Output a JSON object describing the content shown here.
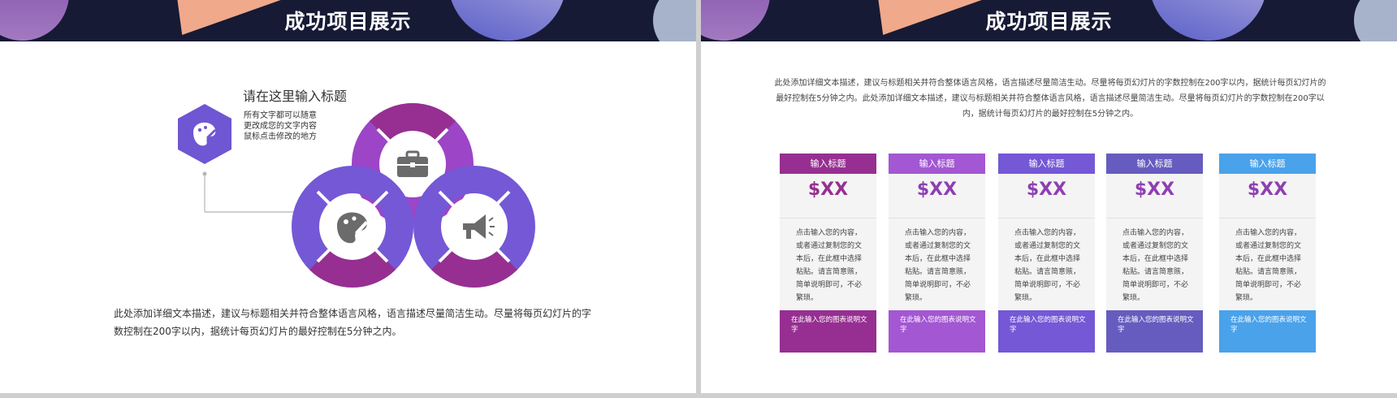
{
  "left_slide": {
    "title": "成功项目展示",
    "heading": "请在这里输入标题",
    "side_text": "所有文字都可以随意更改成您的文字内容 鼠标点击修改的地方",
    "bottom_text": "此处添加详细文本描述，建议与标题相关并符合整体语言风格，语言描述尽量简洁生动。尽量将每页幻灯片的字数控制在200字以内，据统计每页幻灯片的最好控制在5分钟之内。"
  },
  "right_slide": {
    "title": "成功项目展示",
    "intro": "此处添加详细文本描述，建议与标题相关并符合整体语言风格，语言描述尽量简洁生动。尽量将每页幻灯片的字数控制在200字以内，据统计每页幻灯片的最好控制在5分钟之内。此处添加详细文本描述，建议与标题相关并符合整体语言风格，语言描述尽量简洁生动。尽量将每页幻灯片的字数控制在200字以内，据统计每页幻灯片的最好控制在5分钟之内。",
    "cards": [
      {
        "head": "输入标题",
        "price": "$XX",
        "body": "点击输入您的内容，或者通过复制您的文本后，在此框中选择粘贴。请言简意赅，简单说明即可，不必繁琐。",
        "foot": "在此输入您的图表说明文字",
        "color": "#962f91",
        "price_color": "#962f91"
      },
      {
        "head": "输入标题",
        "price": "$XX",
        "body": "点击输入您的内容，或者通过复制您的文本后，在此框中选择粘贴。请言简意赅，简单说明即可，不必繁琐。",
        "foot": "在此输入您的图表说明文字",
        "color": "#a357d2",
        "price_color": "#8e3fb3"
      },
      {
        "head": "输入标题",
        "price": "$XX",
        "body": "点击输入您的内容，或者通过复制您的文本后，在此框中选择粘贴。请言简意赅，简单说明即可，不必繁琐。",
        "foot": "在此输入您的图表说明文字",
        "color": "#7458d6",
        "price_color": "#8e3fb3"
      },
      {
        "head": "输入标题",
        "price": "$XX",
        "body": "点击输入您的内容，或者通过复制您的文本后，在此框中选择粘贴。请言简意赅，简单说明即可，不必繁琐。",
        "foot": "在此输入您的图表说明文字",
        "color": "#665cbf",
        "price_color": "#8e3fb3"
      },
      {
        "head": "输入标题",
        "price": "$XX",
        "body": "点击输入您的内容，或者通过复制您的文本后，在此框中选择粘贴。请言简意赅，简单说明即可，不必繁琐。",
        "foot": "在此输入您的图表说明文字",
        "color": "#4aa2ea",
        "price_color": "#8e3fb3"
      }
    ]
  },
  "icons": {
    "hexagon": "palette-icon",
    "top_circle": "briefcase-icon",
    "left_circle": "palette-icon",
    "right_circle": "megaphone-icon"
  },
  "colors": {
    "header_bg": "#161a35",
    "purple_dark": "#962f91",
    "violet": "#7458d6",
    "magenta_light": "#a357d2"
  }
}
